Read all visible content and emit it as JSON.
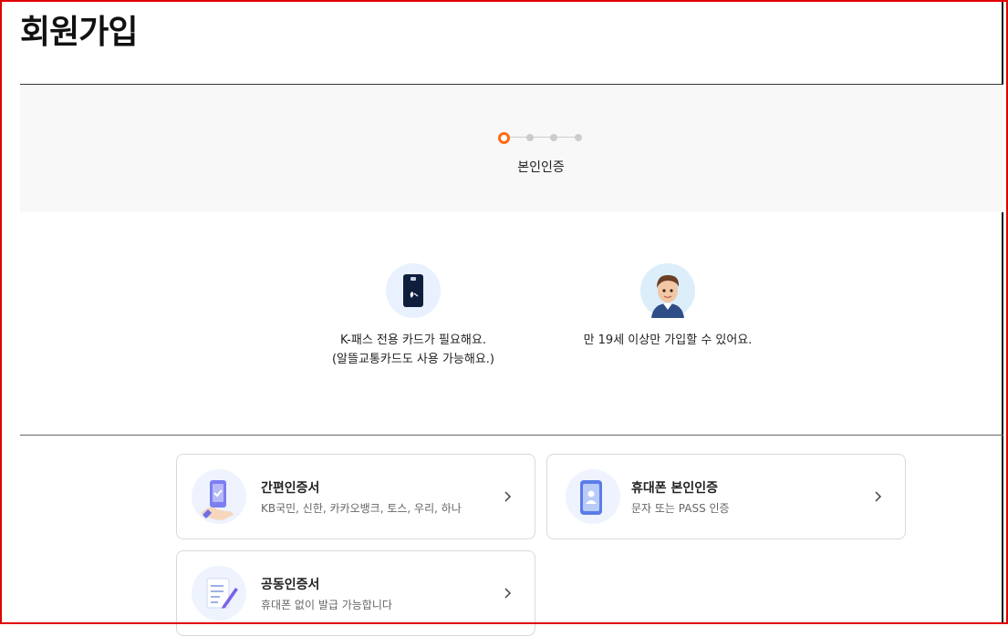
{
  "page": {
    "title": "회원가입"
  },
  "stepper": {
    "current_label": "본인인증",
    "total_steps": 4,
    "current_step": 1,
    "accent_color": "#ff6a13"
  },
  "info": [
    {
      "icon": "card-icon",
      "lines": [
        "K-패스 전용 카드가 필요해요.",
        "(알뜰교통카드도 사용 가능해요.)"
      ]
    },
    {
      "icon": "person-avatar-icon",
      "lines": [
        "만 19세 이상만 가입할 수 있어요."
      ]
    }
  ],
  "auth_options": [
    {
      "title": "간편인증서",
      "desc": "KB국민, 신한, 카카오뱅크, 토스, 우리, 하나",
      "icon": "simple-certificate-icon"
    },
    {
      "title": "휴대폰 본인인증",
      "desc": "문자 또는 PASS 인증",
      "icon": "mobile-phone-icon"
    },
    {
      "title": "공동인증서",
      "desc": "휴대폰 없이 발급 가능합니다",
      "icon": "joint-certificate-icon"
    }
  ]
}
